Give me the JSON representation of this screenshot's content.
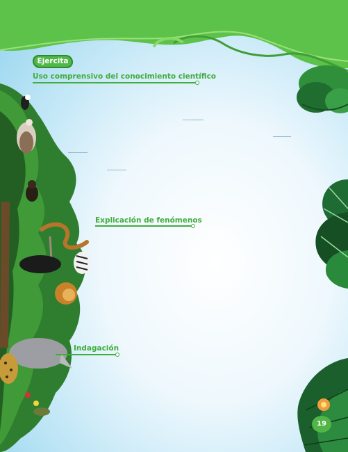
{
  "badge": {
    "label": "Ejercita"
  },
  "sections": [
    {
      "title": "Uso comprensivo del conocimiento científico"
    },
    {
      "title": "Explicación de fenómenos"
    },
    {
      "title": "Indagación"
    }
  ],
  "page_number": "19",
  "colors": {
    "heading_green": "#42ac3f",
    "banner_green": "#5cc24a",
    "sky_blue": "#93d3ee"
  },
  "illustration": {
    "left_side": "jungle-animals-illustration",
    "right_side": "tropical-leaves-illustration",
    "top": "green-leaf-banner"
  }
}
